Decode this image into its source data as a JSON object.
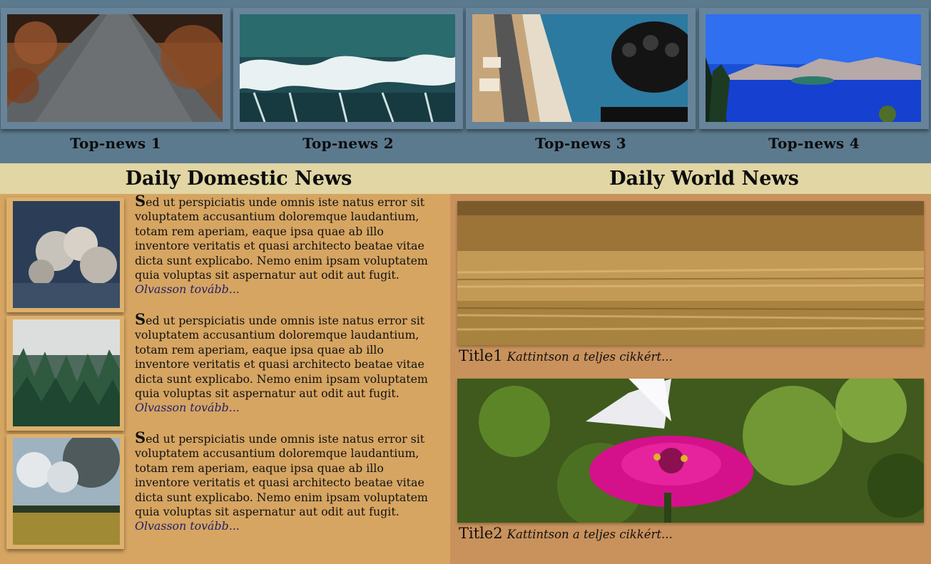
{
  "top_news": [
    {
      "title": "Top-news 1"
    },
    {
      "title": "Top-news 2"
    },
    {
      "title": "Top-news 3"
    },
    {
      "title": "Top-news 4"
    }
  ],
  "domestic": {
    "heading": "Daily Domestic News",
    "articles": [
      {
        "first_letter": "S",
        "text": "ed ut perspiciatis unde omnis iste natus error sit voluptatem accusantium doloremque laudantium, totam rem aperiam, eaque ipsa quae ab illo inventore veritatis et quasi architecto beatae vitae dicta sunt explicabo. Nemo enim ipsam voluptatem quia voluptas sit aspernatur aut odit aut fugit.",
        "more": "Olvasson tovább..."
      },
      {
        "first_letter": "S",
        "text": "ed ut perspiciatis unde omnis iste natus error sit voluptatem accusantium doloremque laudantium, totam rem aperiam, eaque ipsa quae ab illo inventore veritatis et quasi architecto beatae vitae dicta sunt explicabo. Nemo enim ipsam voluptatem quia voluptas sit aspernatur aut odit aut fugit.",
        "more": "Olvasson tovább..."
      },
      {
        "first_letter": "S",
        "text": "ed ut perspiciatis unde omnis iste natus error sit voluptatem accusantium doloremque laudantium, totam rem aperiam, eaque ipsa quae ab illo inventore veritatis et quasi architecto beatae vitae dicta sunt explicabo. Nemo enim ipsam voluptatem quia voluptas sit aspernatur aut odit aut fugit.",
        "more": "Olvasson tovább..."
      }
    ]
  },
  "world": {
    "heading": "Daily World News",
    "articles": [
      {
        "title": "Title1",
        "link": "Kattintson a teljes cikkért..."
      },
      {
        "title": "Title2",
        "link": "Kattintson a teljes cikkért..."
      }
    ]
  },
  "colors": {
    "top_strip": "#5c7a8e",
    "header_band": "#e1d6a4",
    "domestic_bg": "#d6a562",
    "world_bg": "#c9925c",
    "link": "#1f1f6a"
  }
}
